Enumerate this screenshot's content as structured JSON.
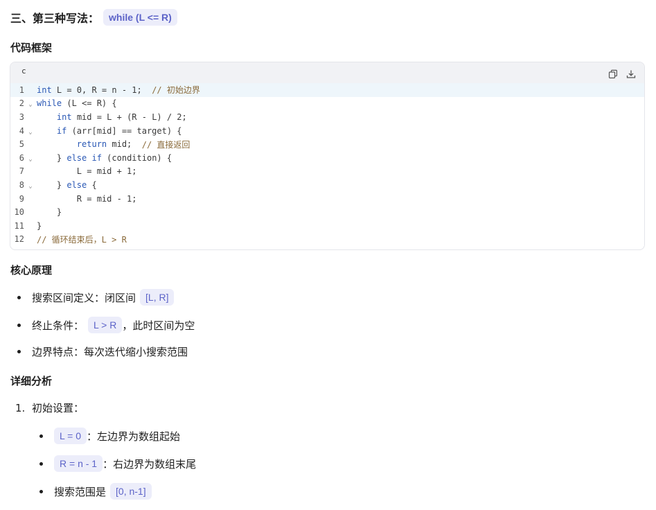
{
  "section": {
    "title": "三、第三种写法：",
    "title_code": "while (L <= R)"
  },
  "framework": {
    "heading": "代码框架",
    "language": "c",
    "copy_icon": "copy-icon",
    "download_icon": "download-icon",
    "lines": [
      {
        "n": "1",
        "fold": "",
        "text": "int L = 0, R = n - 1;  ",
        "comment": "// 初始边界"
      },
      {
        "n": "2",
        "fold": "⌄",
        "text": "while (L <= R) {",
        "comment": ""
      },
      {
        "n": "3",
        "fold": "",
        "text": "    int mid = L + (R - L) / 2;",
        "comment": ""
      },
      {
        "n": "4",
        "fold": "⌄",
        "text": "    if (arr[mid] == target) {",
        "comment": ""
      },
      {
        "n": "5",
        "fold": "",
        "text": "        return mid;  ",
        "comment": "// 直接返回"
      },
      {
        "n": "6",
        "fold": "⌄",
        "text": "    } else if (condition) {",
        "comment": ""
      },
      {
        "n": "7",
        "fold": "",
        "text": "        L = mid + 1;",
        "comment": ""
      },
      {
        "n": "8",
        "fold": "⌄",
        "text": "    } else {",
        "comment": ""
      },
      {
        "n": "9",
        "fold": "",
        "text": "        R = mid - 1;",
        "comment": ""
      },
      {
        "n": "10",
        "fold": "",
        "text": "    }",
        "comment": ""
      },
      {
        "n": "11",
        "fold": "",
        "text": "}",
        "comment": ""
      },
      {
        "n": "12",
        "fold": "",
        "text": "",
        "comment": "// 循环结束后，L > R"
      }
    ]
  },
  "principle": {
    "heading": "核心原理",
    "items": [
      {
        "text": "搜索区间定义：闭区间",
        "code": "[L, R]",
        "suffix": ""
      },
      {
        "text": "终止条件：",
        "code": "L > R",
        "suffix": "，此时区间为空"
      },
      {
        "text": "边界特点：每次迭代缩小搜索范围",
        "code": "",
        "suffix": ""
      }
    ]
  },
  "analysis": {
    "heading": "详细分析",
    "ordered": [
      {
        "num": "1.",
        "text": "初始设置："
      }
    ],
    "sub_items": [
      {
        "code": "L = 0",
        "text": "：左边界为数组起始"
      },
      {
        "code": "R = n - 1",
        "text": "：右边界为数组末尾"
      },
      {
        "prefix": "搜索范围是",
        "code": "[0, n-1]"
      }
    ]
  }
}
